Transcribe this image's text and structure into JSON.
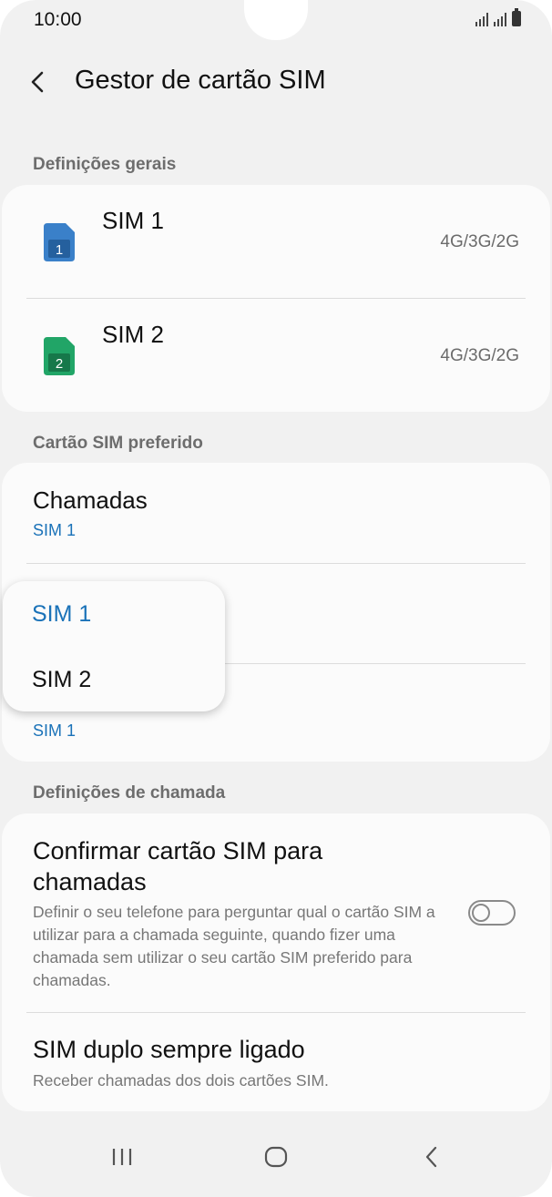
{
  "status_bar": {
    "time": "10:00"
  },
  "header": {
    "title": "Gestor de cartão SIM"
  },
  "sections": {
    "general": "Definições gerais",
    "preferred": "Cartão SIM preferido",
    "call_settings": "Definições de chamada"
  },
  "sims": [
    {
      "name": "SIM 1",
      "number": "1",
      "network": "4G/3G/2G",
      "color": "#3a80c9"
    },
    {
      "name": "SIM 2",
      "number": "2",
      "network": "4G/3G/2G",
      "color": "#21a567"
    }
  ],
  "preferred": {
    "calls_label": "Chamadas",
    "calls_value": "SIM 1",
    "hidden_value": "SIM 1"
  },
  "popup": {
    "options": [
      "SIM 1",
      "SIM 2"
    ],
    "selected_color": "#1a72b8"
  },
  "call_settings": {
    "confirm_title": "Confirmar cartão SIM para chamadas",
    "confirm_desc": "Definir o seu telefone para perguntar qual o cartão SIM a utilizar para a chamada seguinte, quando fizer uma chamada sem utilizar o seu cartão SIM preferido para chamadas.",
    "confirm_enabled": false,
    "dual_title": "SIM duplo sempre ligado",
    "dual_desc": "Receber chamadas dos dois cartões SIM."
  },
  "nav": {
    "icons": [
      "recents-icon",
      "home-icon",
      "back-icon"
    ]
  }
}
